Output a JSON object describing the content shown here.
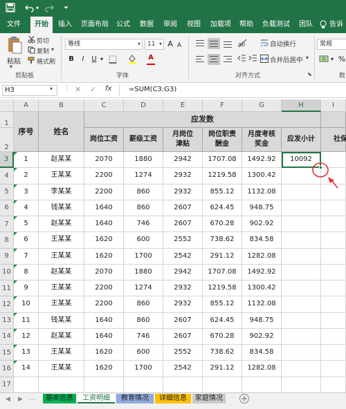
{
  "quick_access": {
    "save_icon": "save-icon",
    "undo_icon": "undo-icon",
    "redo_icon": "redo-icon"
  },
  "ribbon_tabs": [
    "文件",
    "开始",
    "插入",
    "页面布局",
    "公式",
    "数据",
    "审阅",
    "视图",
    "加载项",
    "帮助",
    "负载测试",
    "团队",
    "告诉"
  ],
  "active_tab": "开始",
  "clipboard": {
    "paste": "粘贴",
    "cut": "剪切",
    "copy": "复制",
    "format_painter": "格式刷",
    "group": "剪贴板"
  },
  "font": {
    "name": "等线",
    "size": "11",
    "bold": "B",
    "italic": "I",
    "underline": "U",
    "font_color_glyph": "A",
    "increase": "A",
    "decrease": "A",
    "group": "字体"
  },
  "alignment": {
    "wrap": "自动换行",
    "merge": "合并后居中",
    "group": "对齐方式"
  },
  "number": {
    "format": "常规",
    "group": "数"
  },
  "formula_bar": {
    "name_box": "H3",
    "formula": "=SUM(C3:G3)"
  },
  "columns": [
    "A",
    "B",
    "C",
    "D",
    "E",
    "F",
    "G",
    "H",
    "I"
  ],
  "rows": [
    "1",
    "2",
    "3",
    "4",
    "5",
    "6",
    "7",
    "8",
    "9",
    "10",
    "11",
    "12",
    "13",
    "14",
    "15",
    "16",
    "17"
  ],
  "table": {
    "seq_header": "序号",
    "name_header": "姓名",
    "group_header": "应发数",
    "sub_headers": [
      "岗位工资",
      "薪级工资",
      "月岗位津贴",
      "岗位职责酬金",
      "月度考核奖金",
      "应发小计",
      "社保"
    ],
    "rows": [
      [
        "1",
        "赵某某",
        "2070",
        "1880",
        "2942",
        "1707.08",
        "1492.92",
        "10092"
      ],
      [
        "2",
        "王某某",
        "2200",
        "1274",
        "2932",
        "1219.58",
        "1300.42",
        ""
      ],
      [
        "3",
        "李某某",
        "2200",
        "860",
        "2932",
        "855.12",
        "1132.08",
        ""
      ],
      [
        "4",
        "钱某某",
        "1640",
        "860",
        "2607",
        "624.45",
        "948.75",
        ""
      ],
      [
        "5",
        "赵某某",
        "1640",
        "746",
        "2607",
        "670.28",
        "902.92",
        ""
      ],
      [
        "6",
        "王某某",
        "1620",
        "600",
        "2552",
        "738.62",
        "834.58",
        ""
      ],
      [
        "7",
        "王某某",
        "1620",
        "1700",
        "2542",
        "291.12",
        "1282.08",
        ""
      ],
      [
        "8",
        "赵某某",
        "2070",
        "1880",
        "2942",
        "1707.08",
        "1492.92",
        ""
      ],
      [
        "9",
        "王某某",
        "2200",
        "1274",
        "2932",
        "1219.58",
        "1300.42",
        ""
      ],
      [
        "10",
        "王某某",
        "2200",
        "860",
        "2932",
        "855.12",
        "1132.08",
        ""
      ],
      [
        "11",
        "钱某某",
        "1640",
        "860",
        "2607",
        "624.45",
        "948.75",
        ""
      ],
      [
        "12",
        "赵某某",
        "1640",
        "746",
        "2607",
        "670.28",
        "902.92",
        ""
      ],
      [
        "13",
        "王某某",
        "1620",
        "600",
        "2552",
        "738.62",
        "834.58",
        ""
      ],
      [
        "14",
        "王某某",
        "1620",
        "1700",
        "2542",
        "291.12",
        "1282.08",
        ""
      ]
    ]
  },
  "sheet_tabs": [
    {
      "label": "基本信息",
      "color": "#00b050"
    },
    {
      "label": "工资明细",
      "color": "#ffffff",
      "active": true
    },
    {
      "label": "教育情况",
      "color": "#8ea9db"
    },
    {
      "label": "详细信息",
      "color": "#ffc000"
    },
    {
      "label": "家庭情况",
      "color": "#c9c9c9"
    }
  ],
  "colors": {
    "accent": "#217346",
    "annotation": "#e03030",
    "header_fill": "#d9d9d9"
  }
}
